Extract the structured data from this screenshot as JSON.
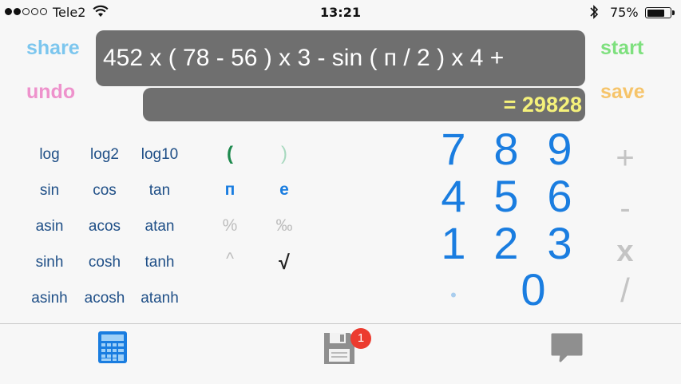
{
  "status": {
    "carrier": "Tele2",
    "time": "13:21",
    "battery": "75%",
    "battery_level": 0.75,
    "signal_bars": 2
  },
  "actions": {
    "share": "share",
    "undo": "undo",
    "start": "start",
    "save": "save"
  },
  "display": {
    "expression": "452 x ( 78 - 56 ) x 3 - sin ( п / 2 ) x 4 +",
    "result": "= 29828"
  },
  "functions": [
    [
      "log",
      "log2",
      "log10"
    ],
    [
      "sin",
      "cos",
      "tan"
    ],
    [
      "asin",
      "acos",
      "atan"
    ],
    [
      "sinh",
      "cosh",
      "tanh"
    ],
    [
      "asinh",
      "acosh",
      "atanh"
    ]
  ],
  "symbols": {
    "open_paren": "(",
    "close_paren": ")",
    "pi": "п",
    "e": "e",
    "percent": "%",
    "permille": "‰",
    "power": "^",
    "sqrt": "√"
  },
  "digits": {
    "row1": [
      "7",
      "8",
      "9"
    ],
    "row2": [
      "4",
      "5",
      "6"
    ],
    "row3": [
      "1",
      "2",
      "3"
    ],
    "zero": "0",
    "dot": "•"
  },
  "operators": {
    "plus": "+",
    "minus": "-",
    "multiply": "x",
    "divide": "/"
  },
  "tabs": {
    "calculator": "calculator-icon",
    "saved": "floppy-disk-icon",
    "saved_badge": "1",
    "feedback": "speech-bubble-icon"
  },
  "colors": {
    "share": "#7cc6ee",
    "undo": "#ee92cc",
    "start": "#7ee07e",
    "save": "#f6c46a",
    "display_bg": "#6f6f6f",
    "result_text": "#f5f17a",
    "digits": "#1a7de0",
    "functions": "#1f4f87"
  }
}
